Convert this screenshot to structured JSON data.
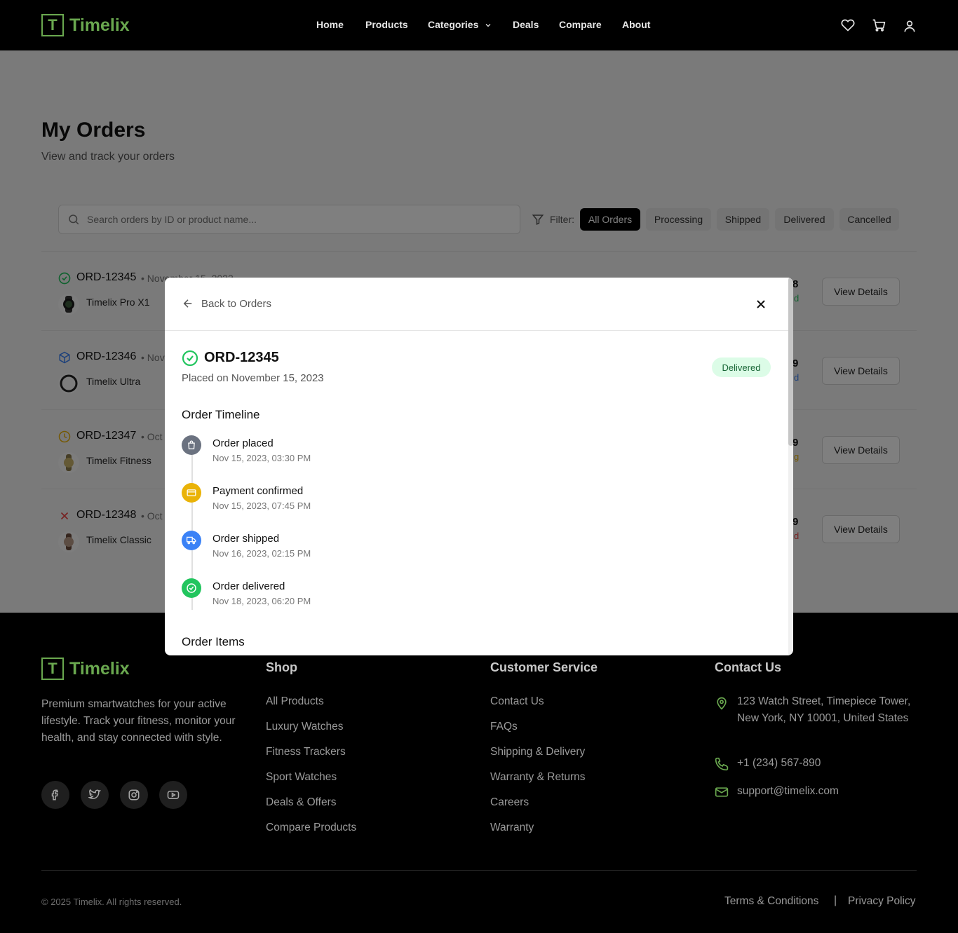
{
  "brand": {
    "letter": "T",
    "name": "Timelix"
  },
  "nav": {
    "links": [
      "Home",
      "Products",
      "Categories",
      "Deals",
      "Compare",
      "About"
    ],
    "icons": [
      "heart-icon",
      "cart-icon",
      "user-icon"
    ]
  },
  "page": {
    "title": "My Orders",
    "subtitle": "View and track your orders",
    "search_placeholder": "Search orders by ID or product name...",
    "filter_label": "Filter:",
    "filters": [
      "All Orders",
      "Processing",
      "Shipped",
      "Delivered",
      "Cancelled"
    ],
    "active_filter": "All Orders"
  },
  "orders": [
    {
      "id": "ORD-12345",
      "date": "• November 15, 2023",
      "status": "delivered",
      "product": "Timelix Pro X1",
      "total_tail": "8",
      "status_tail": "d",
      "view_label": "View Details"
    },
    {
      "id": "ORD-12346",
      "date": "• Nov",
      "status": "shipped",
      "product": "Timelix Ultra",
      "total_tail": "9",
      "status_tail": "d",
      "view_label": "View Details"
    },
    {
      "id": "ORD-12347",
      "date": "• Oct",
      "status": "processing",
      "product": "Timelix Fitness",
      "total_tail": "9",
      "status_tail": "g",
      "view_label": "View Details"
    },
    {
      "id": "ORD-12348",
      "date": "• Oct",
      "status": "cancelled",
      "product": "Timelix Classic",
      "total_tail": "9",
      "status_tail": "d",
      "view_label": "View Details"
    }
  ],
  "modal": {
    "back_label": "Back to Orders",
    "order_id": "ORD-12345",
    "placed": "Placed on November 15, 2023",
    "badge": "Delivered",
    "timeline_title": "Order Timeline",
    "timeline": [
      {
        "title": "Order placed",
        "time": "Nov 15, 2023, 03:30 PM",
        "color": "#6b7280",
        "icon": "bag-icon"
      },
      {
        "title": "Payment confirmed",
        "time": "Nov 15, 2023, 07:45 PM",
        "color": "#eab308",
        "icon": "credit-card-icon"
      },
      {
        "title": "Order shipped",
        "time": "Nov 16, 2023, 02:15 PM",
        "color": "#3b82f6",
        "icon": "truck-icon"
      },
      {
        "title": "Order delivered",
        "time": "Nov 18, 2023, 06:20 PM",
        "color": "#22c55e",
        "icon": "check-circle-icon"
      }
    ],
    "items_title": "Order Items"
  },
  "footer": {
    "description": "Premium smartwatches for your active lifestyle. Track your fitness, monitor your health, and stay connected with style.",
    "socials": [
      "facebook-icon",
      "twitter-icon",
      "instagram-icon",
      "youtube-icon"
    ],
    "shop_title": "Shop",
    "shop_links": [
      "All Products",
      "Luxury Watches",
      "Fitness Trackers",
      "Sport Watches",
      "Deals & Offers",
      "Compare Products"
    ],
    "service_title": "Customer Service",
    "service_links": [
      "Contact Us",
      "FAQs",
      "Shipping & Delivery",
      "Warranty & Returns",
      "Careers",
      "Warranty"
    ],
    "contact_title": "Contact Us",
    "address": "123 Watch Street, Timepiece Tower, New York, NY 10001, United States",
    "phone": "+1 (234) 567-890",
    "email": "support@timelix.com",
    "copyright": "© 2025 Timelix. All rights reserved.",
    "terms": "Terms & Conditions",
    "separator": "|",
    "privacy": "Privacy Policy"
  },
  "colors": {
    "brand_green": "#6aa84f",
    "delivered": "#22c55e",
    "shipped": "#3b82f6",
    "processing": "#eab308",
    "cancelled": "#ef4444"
  }
}
